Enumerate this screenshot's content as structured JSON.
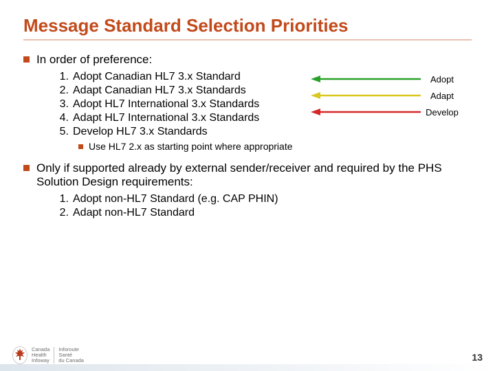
{
  "title": "Message Standard Selection Priorities",
  "section1": {
    "lead": "In order of preference:",
    "items": [
      "Adopt Canadian HL7 3.x Standard",
      "Adapt Canadian HL7 3.x Standards",
      "Adopt HL7 International 3.x Standards",
      "Adapt HL7 International 3.x Standards",
      "Develop HL7 3.x Standards"
    ],
    "sub": "Use HL7 2.x as starting point where appropriate"
  },
  "arrows": [
    {
      "label": "Adopt",
      "color": "#2aa12a",
      "y_offset": 0
    },
    {
      "label": "Adapt",
      "color": "#d8c81f",
      "y_offset": 0
    },
    {
      "label": "Develop",
      "color": "#d62728",
      "y_offset": 0
    }
  ],
  "section2": {
    "lead": "Only if supported already by external sender/receiver and required by the PHS Solution Design requirements:",
    "items": [
      "Adopt non-HL7 Standard (e.g. CAP PHIN)",
      "Adapt non-HL7 Standard"
    ]
  },
  "footer": {
    "page": "13",
    "logo": {
      "maple_color": "#b83a1a",
      "en": [
        "Canada",
        "Health",
        "Infoway"
      ],
      "fr": [
        "Inforoute",
        "Santé",
        "du Canada"
      ]
    }
  }
}
